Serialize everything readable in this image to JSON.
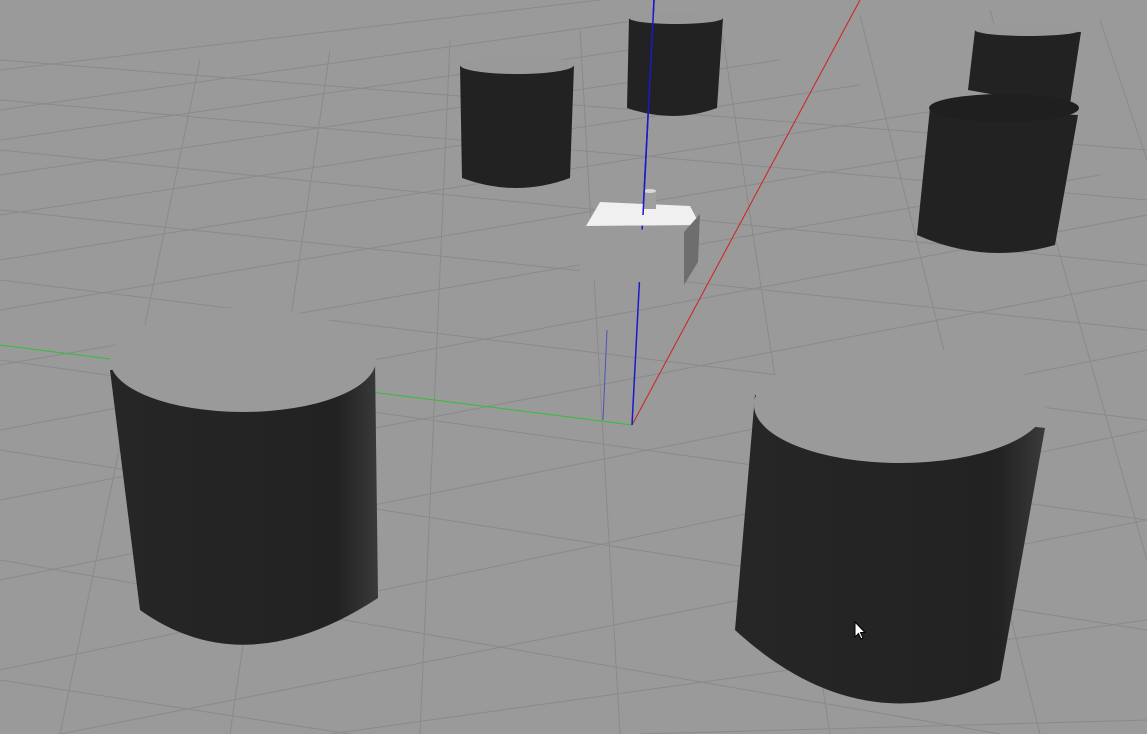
{
  "viewport": {
    "background": "#9a9a9a",
    "grid_color": "#8a8a8a",
    "axis_colors": {
      "x": "#d02020",
      "y": "#30c030",
      "z": "#1a1acc"
    }
  },
  "objects": {
    "cylinder_color": "#222222",
    "robot_color": "#e8e8e8",
    "cylinder_count": 6,
    "robot_count": 1
  },
  "cursor": {
    "icon": "arrow-cursor-icon"
  }
}
